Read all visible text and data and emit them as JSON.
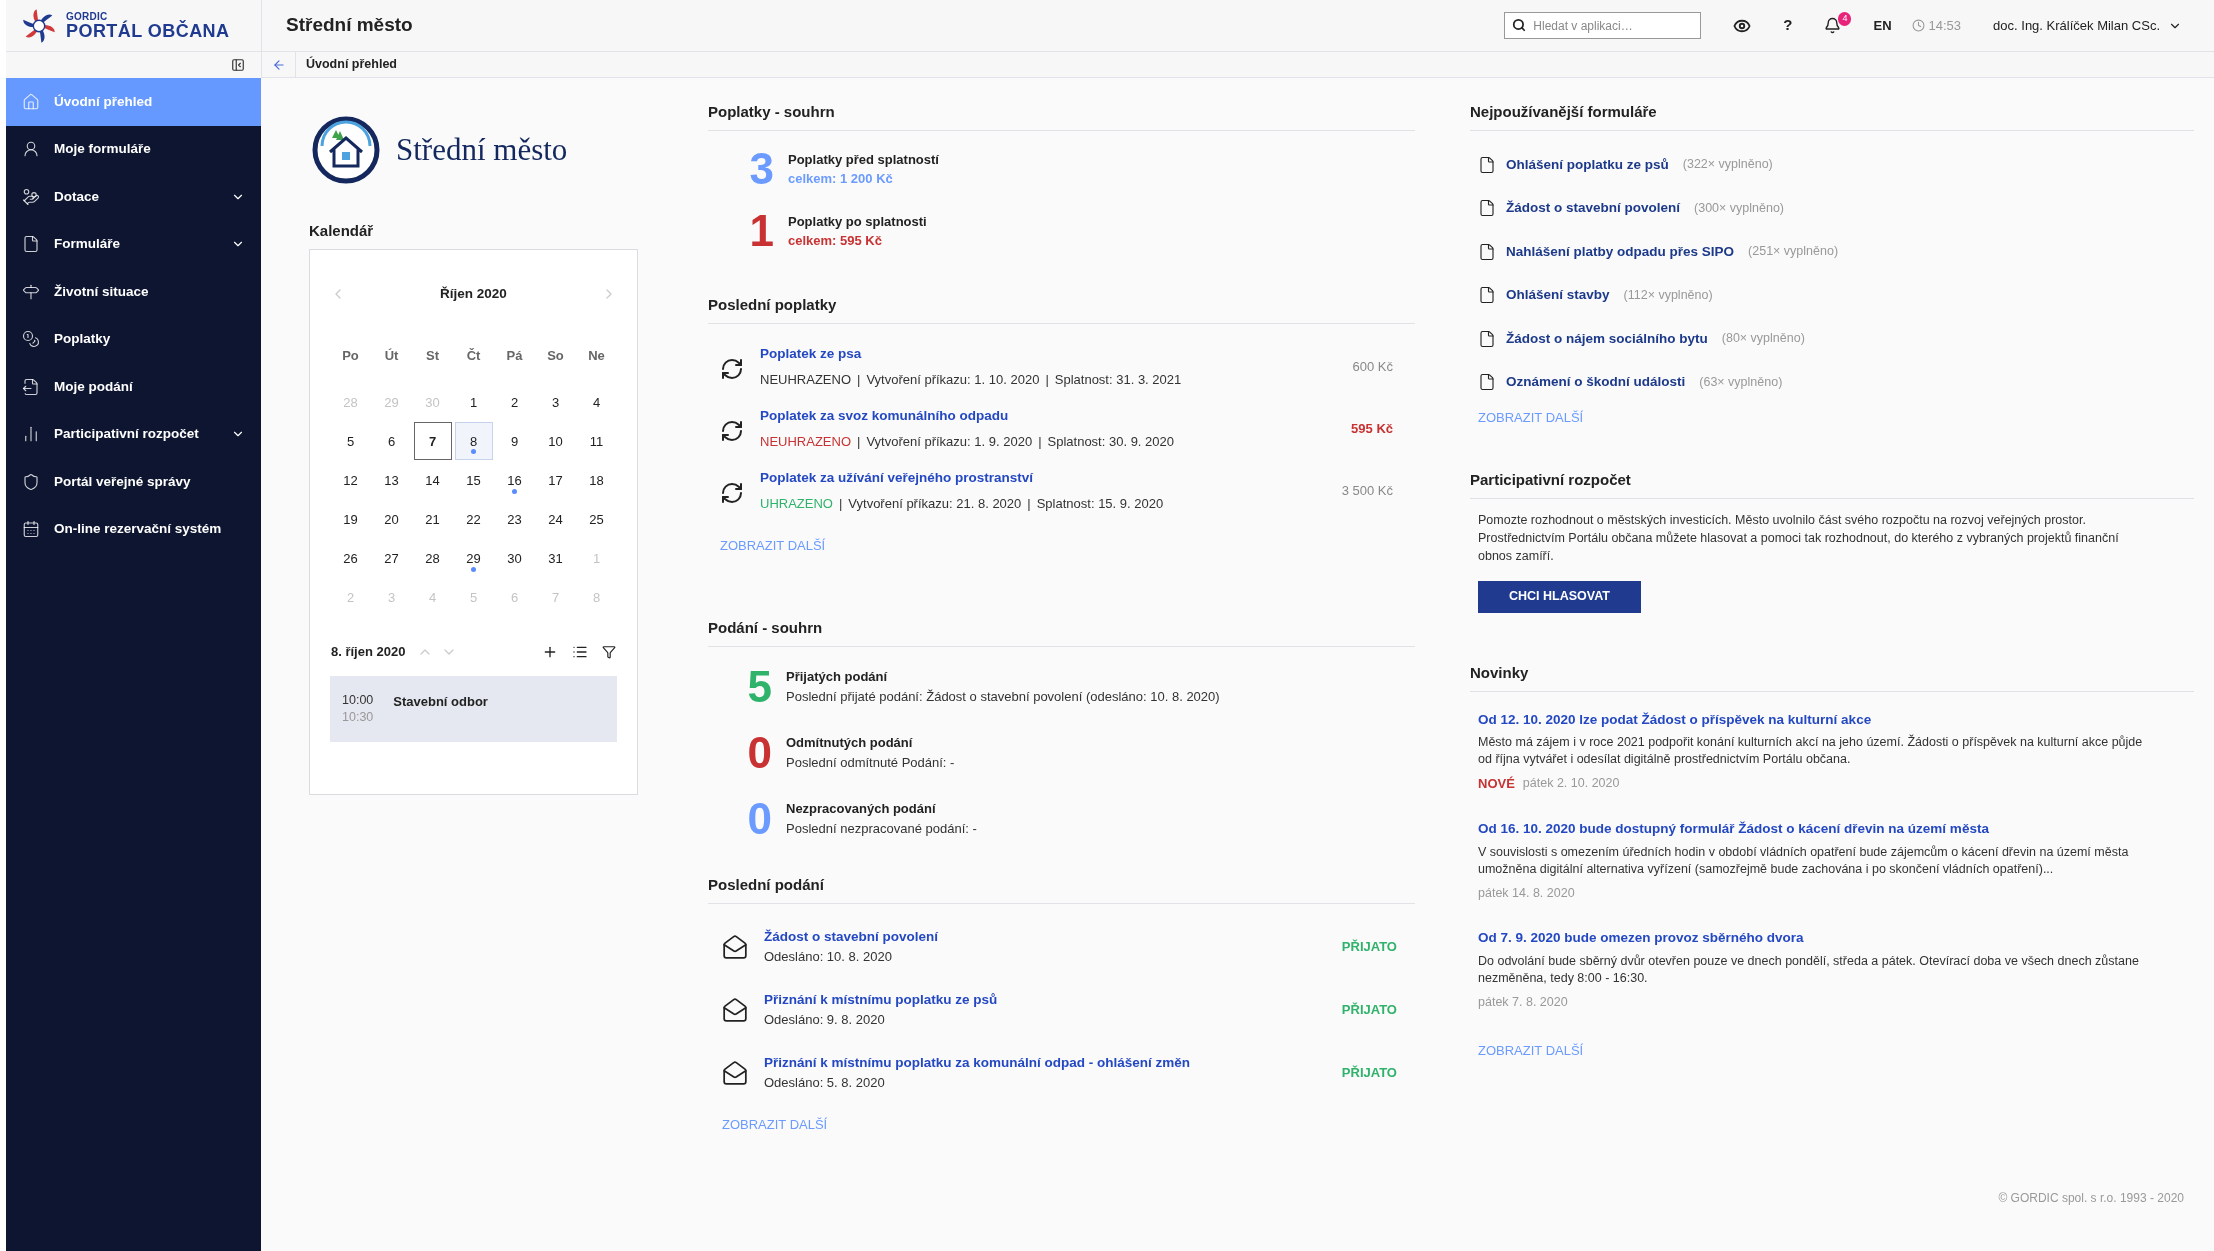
{
  "logo": {
    "brand": "GORDIC",
    "product": "PORTÁL OBČANA"
  },
  "header": {
    "title": "Střední město",
    "search": {
      "placeholder": "Hledat v aplikaci…"
    },
    "help": "?",
    "notifications": "4",
    "language": "EN",
    "time": "14:53",
    "user": "doc. Ing. Králíček Milan CSc."
  },
  "breadcrumb": "Úvodní přehled",
  "sidebar": {
    "items": [
      {
        "kind": "home",
        "label": "Úvodní přehled",
        "selected": true,
        "submenu": false
      },
      {
        "kind": "person",
        "label": "Moje formuláře",
        "selected": false,
        "submenu": false
      },
      {
        "kind": "hand",
        "label": "Dotace",
        "selected": false,
        "submenu": true
      },
      {
        "kind": "file",
        "label": "Formuláře",
        "selected": false,
        "submenu": true
      },
      {
        "kind": "signpost",
        "label": "Životní situace",
        "selected": false,
        "submenu": false
      },
      {
        "kind": "coins",
        "label": "Poplatky",
        "selected": false,
        "submenu": false
      },
      {
        "kind": "submit",
        "label": "Moje podání",
        "selected": false,
        "submenu": false
      },
      {
        "kind": "chart",
        "label": "Participativní rozpočet",
        "selected": false,
        "submenu": true
      },
      {
        "kind": "lion",
        "label": "Portál veřejné správy",
        "selected": false,
        "submenu": false
      },
      {
        "kind": "calendar",
        "label": "On-line rezervační systém",
        "selected": false,
        "submenu": false
      }
    ]
  },
  "city": {
    "name": "Střední město"
  },
  "calendar": {
    "title": "Kalendář",
    "month": "Říjen 2020",
    "weekdays": [
      "Po",
      "Út",
      "St",
      "Čt",
      "Pá",
      "So",
      "Ne"
    ],
    "weeks": [
      [
        {
          "label": "28",
          "muted": true,
          "today": false,
          "selected": false,
          "event": false
        },
        {
          "label": "29",
          "muted": true,
          "today": false,
          "selected": false,
          "event": false
        },
        {
          "label": "30",
          "muted": true,
          "today": false,
          "selected": false,
          "event": false
        },
        {
          "label": "1",
          "muted": false,
          "today": false,
          "selected": false,
          "event": false
        },
        {
          "label": "2",
          "muted": false,
          "today": false,
          "selected": false,
          "event": false
        },
        {
          "label": "3",
          "muted": false,
          "today": false,
          "selected": false,
          "event": false
        },
        {
          "label": "4",
          "muted": false,
          "today": false,
          "selected": false,
          "event": false
        }
      ],
      [
        {
          "label": "5",
          "muted": false,
          "today": false,
          "selected": false,
          "event": false
        },
        {
          "label": "6",
          "muted": false,
          "today": false,
          "selected": false,
          "event": false
        },
        {
          "label": "7",
          "muted": false,
          "today": true,
          "selected": false,
          "event": false
        },
        {
          "label": "8",
          "muted": false,
          "today": false,
          "selected": true,
          "event": true
        },
        {
          "label": "9",
          "muted": false,
          "today": false,
          "selected": false,
          "event": false
        },
        {
          "label": "10",
          "muted": false,
          "today": false,
          "selected": false,
          "event": false
        },
        {
          "label": "11",
          "muted": false,
          "today": false,
          "selected": false,
          "event": false
        }
      ],
      [
        {
          "label": "12",
          "muted": false,
          "today": false,
          "selected": false,
          "event": false
        },
        {
          "label": "13",
          "muted": false,
          "today": false,
          "selected": false,
          "event": false
        },
        {
          "label": "14",
          "muted": false,
          "today": false,
          "selected": false,
          "event": false
        },
        {
          "label": "15",
          "muted": false,
          "today": false,
          "selected": false,
          "event": false
        },
        {
          "label": "16",
          "muted": false,
          "today": false,
          "selected": false,
          "event": true
        },
        {
          "label": "17",
          "muted": false,
          "today": false,
          "selected": false,
          "event": false
        },
        {
          "label": "18",
          "muted": false,
          "today": false,
          "selected": false,
          "event": false
        }
      ],
      [
        {
          "label": "19",
          "muted": false,
          "today": false,
          "selected": false,
          "event": false
        },
        {
          "label": "20",
          "muted": false,
          "today": false,
          "selected": false,
          "event": false
        },
        {
          "label": "21",
          "muted": false,
          "today": false,
          "selected": false,
          "event": false
        },
        {
          "label": "22",
          "muted": false,
          "today": false,
          "selected": false,
          "event": false
        },
        {
          "label": "23",
          "muted": false,
          "today": false,
          "selected": false,
          "event": false
        },
        {
          "label": "24",
          "muted": false,
          "today": false,
          "selected": false,
          "event": false
        },
        {
          "label": "25",
          "muted": false,
          "today": false,
          "selected": false,
          "event": false
        }
      ],
      [
        {
          "label": "26",
          "muted": false,
          "today": false,
          "selected": false,
          "event": false
        },
        {
          "label": "27",
          "muted": false,
          "today": false,
          "selected": false,
          "event": false
        },
        {
          "label": "28",
          "muted": false,
          "today": false,
          "selected": false,
          "event": false
        },
        {
          "label": "29",
          "muted": false,
          "today": false,
          "selected": false,
          "event": true
        },
        {
          "label": "30",
          "muted": false,
          "today": false,
          "selected": false,
          "event": false
        },
        {
          "label": "31",
          "muted": false,
          "today": false,
          "selected": false,
          "event": false
        },
        {
          "label": "1",
          "muted": true,
          "today": false,
          "selected": false,
          "event": false
        }
      ],
      [
        {
          "label": "2",
          "muted": true,
          "today": false,
          "selected": false,
          "event": false
        },
        {
          "label": "3",
          "muted": true,
          "today": false,
          "selected": false,
          "event": false
        },
        {
          "label": "4",
          "muted": true,
          "today": false,
          "selected": false,
          "event": false
        },
        {
          "label": "5",
          "muted": true,
          "today": false,
          "selected": false,
          "event": false
        },
        {
          "label": "6",
          "muted": true,
          "today": false,
          "selected": false,
          "event": false
        },
        {
          "label": "7",
          "muted": true,
          "today": false,
          "selected": false,
          "event": false
        },
        {
          "label": "8",
          "muted": true,
          "today": false,
          "selected": false,
          "event": false
        }
      ]
    ],
    "day": "8. říjen 2020",
    "events": [
      {
        "start": "10:00",
        "end": "10:30",
        "title": "Stavební odbor"
      }
    ]
  },
  "fees_summary": {
    "title": "Poplatky - souhrn",
    "items": [
      {
        "count": "3",
        "label": "Poplatky před splatností",
        "total": "celkem: 1 200 Kč",
        "color": "#6b9bff"
      },
      {
        "count": "1",
        "label": "Poplatky po splatnosti",
        "total": "celkem: 595 Kč",
        "color": "#c83232"
      }
    ]
  },
  "recent_fees": {
    "title": "Poslední poplatky",
    "items": [
      {
        "title": "Poplatek ze psa",
        "kind": "unpaid",
        "status": "NEUHRAZENO",
        "created": "Vytvoření příkazu: 1. 10. 2020",
        "due": "Splatnost: 31. 3. 2021",
        "amount": "600 Kč"
      },
      {
        "title": "Poplatek za svoz komunálního odpadu",
        "kind": "overdue",
        "status": "NEUHRAZENO",
        "created": "Vytvoření příkazu: 1. 9. 2020",
        "due": "Splatnost: 30. 9. 2020",
        "amount": "595 Kč"
      },
      {
        "title": "Poplatek za užívání veřejného prostranství",
        "kind": "paid",
        "status": "UHRAZENO",
        "created": "Vytvoření příkazu: 21. 8. 2020",
        "due": "Splatnost: 15. 9. 2020",
        "amount": "3 500 Kč"
      }
    ],
    "separator": "|",
    "more": "ZOBRAZIT DALŠÍ"
  },
  "submissions_summary": {
    "title": "Podání - souhrn",
    "items": [
      {
        "count": "5",
        "label": "Přijatých podání",
        "detail": "Poslední přijaté podání: Žádost o stavební povolení (odesláno: 10. 8. 2020)",
        "color": "#2fb36b"
      },
      {
        "count": "0",
        "label": "Odmítnutých podání",
        "detail": "Poslední odmítnuté Podání: -",
        "color": "#c83232"
      },
      {
        "count": "0",
        "label": "Nezpracovaných podání",
        "detail": "Poslední nezpracované podání: -",
        "color": "#6b9bff"
      }
    ]
  },
  "recent_submissions": {
    "title": "Poslední podání",
    "items": [
      {
        "title": "Žádost o stavební povolení",
        "sent": "Odesláno: 10. 8. 2020",
        "status": "PŘIJATO"
      },
      {
        "title": "Přiznání k místnímu poplatku ze psů",
        "sent": "Odesláno: 9. 8. 2020",
        "status": "PŘIJATO"
      },
      {
        "title": "Přiznání k místnímu poplatku za komunální odpad - ohlášení změn",
        "sent": "Odesláno: 5. 8. 2020",
        "status": "PŘIJATO"
      }
    ],
    "more": "ZOBRAZIT DALŠÍ"
  },
  "popular_forms": {
    "title": "Nejpoužívanější formuláře",
    "items": [
      {
        "title": "Ohlášení poplatku ze psů",
        "count": "(322× vyplněno)"
      },
      {
        "title": "Žádost o stavební povolení",
        "count": "(300× vyplněno)"
      },
      {
        "title": "Nahlášení platby odpadu přes SIPO",
        "count": "(251× vyplněno)"
      },
      {
        "title": "Ohlášení stavby",
        "count": "(112× vyplněno)"
      },
      {
        "title": "Žádost o nájem sociálního bytu",
        "count": "(80× vyplněno)"
      },
      {
        "title": "Oznámení o škodní události",
        "count": "(63× vyplněno)"
      }
    ],
    "more": "ZOBRAZIT DALŠÍ"
  },
  "budget": {
    "title": "Participativní rozpočet",
    "text": "Pomozte rozhodnout o městských investicích. Město uvolnilo část svého rozpočtu na rozvoj veřejných prostor. Prostřednictvím Portálu občana můžete hlasovat a pomoci tak rozhodnout, do kterého z vybraných projektů finanční obnos zamíří.",
    "button": "CHCI HLASOVAT"
  },
  "news": {
    "title": "Novinky",
    "items": [
      {
        "title": "Od 12. 10. 2020 lze podat Žádost o příspěvek na kulturní akce",
        "text": "Město má zájem i v roce 2021 podpořit konání kulturních akcí na jeho území. Žádosti o příspěvek na kulturní akce půjde od října vytvářet i odesílat digitálně prostřednictvím Portálu občana.",
        "badge": "NOVÉ",
        "date": "pátek 2. 10. 2020"
      },
      {
        "title": "Od 16. 10. 2020 bude dostupný formulář Žádost o kácení dřevin na území města",
        "text": "V souvislosti s omezením úředních hodin v období vládních opatření bude zájemcům o kácení dřevin na území města umožněna digitální alternativa vyřízení (samozřejmě bude zachována i po skončení vládních opatření)...",
        "date": "pátek 14. 8. 2020"
      },
      {
        "title": "Od 7. 9. 2020 bude omezen provoz sběrného dvora",
        "text": "Do odvolání bude sběrný dvůr otevřen pouze ve dnech pondělí, středa a pátek. Otevírací doba ve všech dnech zůstane nezměněna, tedy 8:00 - 16:30.",
        "date": "pátek 7. 8. 2020"
      }
    ],
    "more": "ZOBRAZIT DALŠÍ"
  },
  "footer": "© GORDIC spol. s r.o. 1993 - 2020"
}
